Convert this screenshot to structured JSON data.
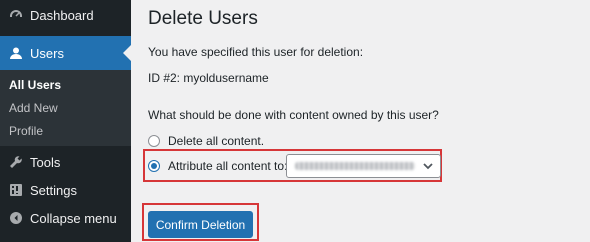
{
  "sidebar": {
    "items": [
      {
        "label": "Dashboard",
        "icon": "dashboard-icon"
      },
      {
        "label": "Users",
        "icon": "users-icon"
      },
      {
        "label": "Tools",
        "icon": "wrench-icon"
      },
      {
        "label": "Settings",
        "icon": "settings-icon"
      },
      {
        "label": "Collapse menu",
        "icon": "collapse-arrow-icon"
      }
    ],
    "submenu": [
      "All Users",
      "Add New",
      "Profile"
    ]
  },
  "main": {
    "title": "Delete Users",
    "intro": "You have specified this user for deletion:",
    "user_line": "ID #2: myoldusername",
    "question": "What should be done with content owned by this user?",
    "option_delete": "Delete all content.",
    "option_attribute": "Attribute all content to:",
    "confirm_label": "Confirm Deletion"
  },
  "colors": {
    "accent": "#2271b1",
    "sidebar_bg": "#1d2327",
    "highlight": "#d63638"
  }
}
